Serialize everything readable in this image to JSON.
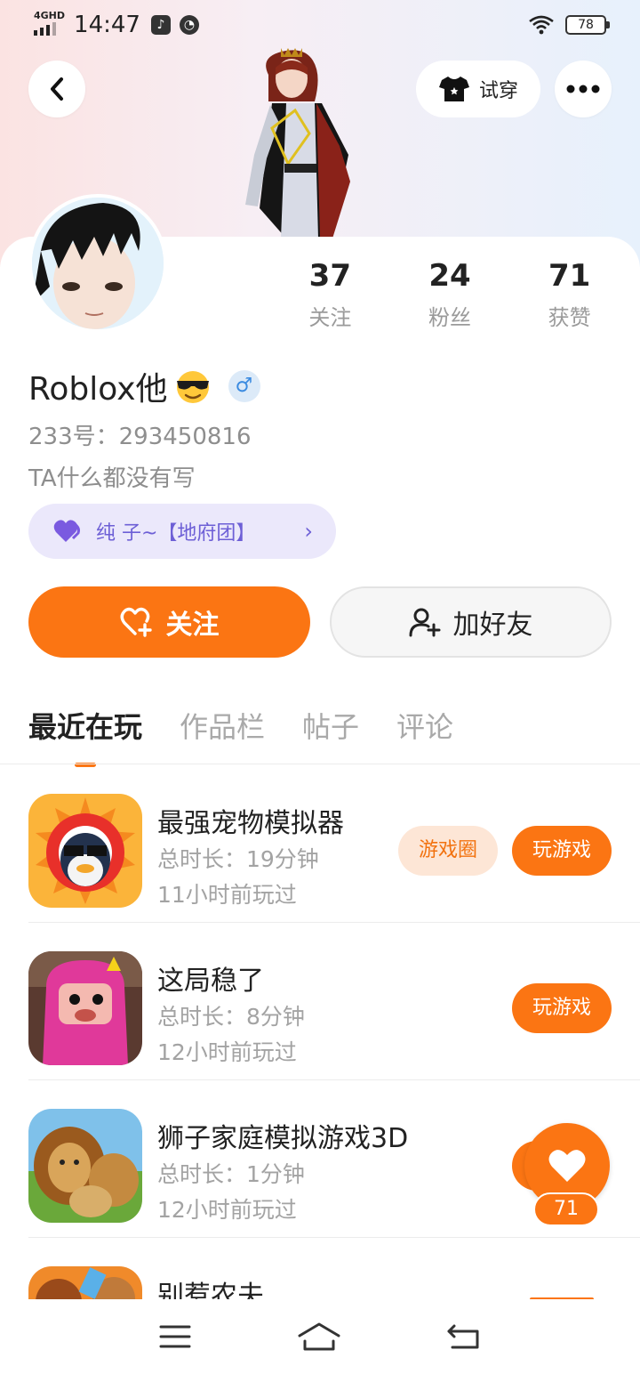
{
  "status_bar": {
    "network": "4GHD",
    "time": "14:47",
    "battery": "78"
  },
  "header": {
    "tryon_label": "试穿"
  },
  "profile": {
    "stats": [
      {
        "value": "37",
        "label": "关注"
      },
      {
        "value": "24",
        "label": "粉丝"
      },
      {
        "value": "71",
        "label": "获赞"
      }
    ],
    "username": "Roblox他",
    "gender_symbol": "♂",
    "uid": "233号：293450816",
    "bio": "TA什么都没有写",
    "group": "纯  子~【地府团】"
  },
  "actions": {
    "follow_label": "关注",
    "add_friend_label": "加好友"
  },
  "tabs": [
    {
      "label": "最近在玩",
      "active": true
    },
    {
      "label": "作品栏",
      "active": false
    },
    {
      "label": "帖子",
      "active": false
    },
    {
      "label": "评论",
      "active": false
    }
  ],
  "games": [
    {
      "name": "最强宠物模拟器",
      "duration": "总时长：19分钟",
      "last_played": "11小时前玩过",
      "circle_label": "游戏圈",
      "play_label": "玩游戏"
    },
    {
      "name": "这局稳了",
      "duration": "总时长：8分钟",
      "last_played": "12小时前玩过",
      "play_label": "玩游戏"
    },
    {
      "name": "狮子家庭模拟游戏3D",
      "duration": "总时长：1分钟",
      "last_played": "12小时前玩过"
    },
    {
      "name": "别惹农夫"
    }
  ],
  "floating_like": {
    "count": "71"
  },
  "colors": {
    "accent": "#fb7513",
    "group_chip_bg": "#ebe8fb",
    "group_chip_text": "#6d5fd6"
  }
}
